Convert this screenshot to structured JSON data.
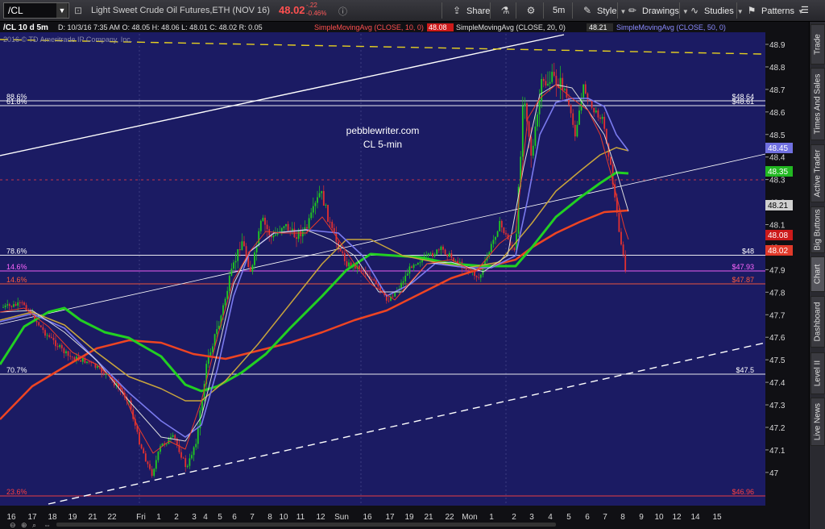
{
  "toolbar": {
    "symbol": "/CL",
    "instrument": "Light Sweet Crude Oil Futures,ETH (NOV 16)",
    "last": "48.02",
    "change": "-.22",
    "change_pct": "-0.46%",
    "buttons": [
      {
        "label": "Share",
        "icon": "share-icon",
        "glyph": "⇪",
        "x": 560
      },
      {
        "label": "",
        "icon": "flask-icon",
        "glyph": "⚗",
        "x": 620
      },
      {
        "label": "",
        "icon": "gear-icon",
        "glyph": "⚙",
        "x": 652
      },
      {
        "label": "5m",
        "icon": "",
        "glyph": "",
        "x": 686
      },
      {
        "label": "Style",
        "icon": "style-icon",
        "glyph": "✎",
        "x": 722
      },
      {
        "label": "Drawings",
        "icon": "drawings-icon",
        "glyph": "✏",
        "x": 778
      },
      {
        "label": "Studies",
        "icon": "studies-icon",
        "glyph": "∿",
        "x": 855
      },
      {
        "label": "Patterns",
        "icon": "patterns-icon",
        "glyph": "⚑",
        "x": 926
      }
    ]
  },
  "chart": {
    "info": {
      "sym": "/CL 10 d 5m",
      "ohlc": "D: 10/3/16 7:35 AM   O: 48.05   H: 48.06   L: 48.01   C: 48.02   R: 0.05",
      "sma10_label": "SimpleMovingAvg (CLOSE, 10, 0)",
      "sma10_val": "48.08",
      "sma20_label": "SimpleMovingAvg (CLOSE, 20, 0)",
      "sma20_val": "48.21",
      "sma50_label": "SimpleMovingAvg (CLOSE, 50, 0)"
    },
    "copyright": "2016 © TD Ameritrade IP Company, Inc.",
    "watermark": [
      "pebblewriter.com",
      "CL 5-min"
    ],
    "y_ticks": [
      "48.9",
      "48.8",
      "48.7",
      "48.6",
      "48.5",
      "48.4",
      "48.3",
      "48.2",
      "48.1",
      "48",
      "47.9",
      "47.8",
      "47.7",
      "47.6",
      "47.5",
      "47.4",
      "47.3",
      "47.2",
      "47.1",
      "47"
    ],
    "x_ticks": [
      "16",
      "17",
      "18",
      "19",
      "21",
      "22",
      "Fri",
      "1",
      "2",
      "3",
      "4",
      "5",
      "6",
      "7",
      "8",
      "10",
      "11",
      "12",
      "Sun",
      "16",
      "17",
      "19",
      "21",
      "22",
      "Mon",
      "1",
      "2",
      "3",
      "4",
      "5",
      "6",
      "7",
      "8",
      "9",
      "10",
      "12",
      "14",
      "15"
    ],
    "fib_levels": [
      {
        "left": "88.6%",
        "right": "$48.64",
        "color": "#ffffff"
      },
      {
        "left": "61.8%",
        "right": "$48.61",
        "color": "#ffffff"
      },
      {
        "left": "78.6%",
        "right": "$48",
        "color": "#ffffff"
      },
      {
        "left": "14.6%",
        "right": "$47.93",
        "color": "#ff66ff"
      },
      {
        "left": "14.6%",
        "right": "$47.87",
        "color": "#ff5a3c"
      },
      {
        "left": "70.7%",
        "right": "$47.5",
        "color": "#ffffff"
      },
      {
        "left": "23.6%",
        "right": "$46.96",
        "color": "#ff4040"
      }
    ],
    "price_badges": [
      {
        "value": "48.45",
        "color": "#7070e0"
      },
      {
        "value": "48.35",
        "color": "#22b822"
      },
      {
        "value": "48.21",
        "color": "#d0d0d0"
      },
      {
        "value": "48.08",
        "color": "#cc1a1a"
      },
      {
        "value": "48.02",
        "color": "#e23a2a"
      }
    ]
  },
  "sidebar": {
    "tabs": [
      "Trade",
      "Times And Sales",
      "Active Trader",
      "Big Buttons",
      "Chart",
      "Dashboard",
      "Level II",
      "Live News"
    ],
    "active": "Chart"
  },
  "colors": {
    "bg": "#1b1b63",
    "up": "#1fcc1f",
    "down": "#e33030",
    "sma10": "#e83a2a",
    "sma20": "#dddddd",
    "sma50": "#7a7aee",
    "sma100": "#c8a43c",
    "sma200_green": "#22d022",
    "sma_red": "#ee4422"
  }
}
